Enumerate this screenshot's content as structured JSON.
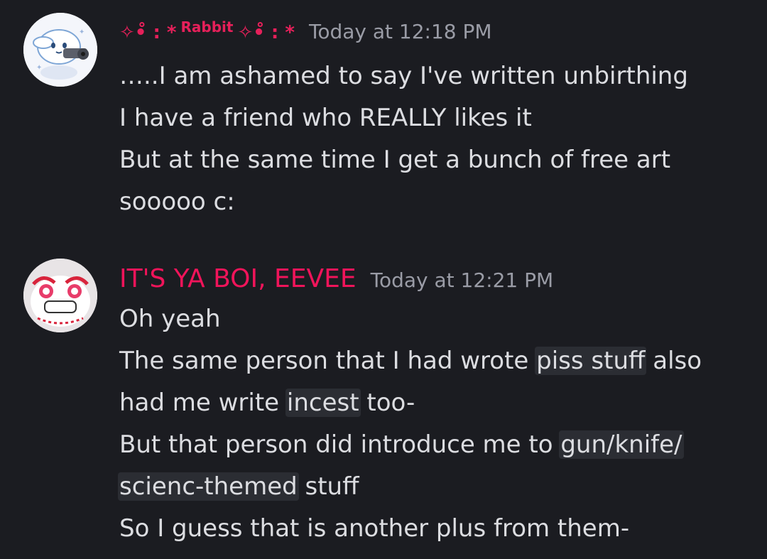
{
  "messages": [
    {
      "author": {
        "name": "Rabbit",
        "decor_left": "✧•̊ : *",
        "decor_right": "✧•̊ : *",
        "color": "#e6205a"
      },
      "timestamp": "Today at 12:18 PM",
      "avatar_icon": "cinnamoroll-with-gun-avatar",
      "lines": [
        "…..I am ashamed to say I've written unbirthing",
        "I have a friend who REALLY likes it",
        "But at the same time I get a bunch of free art",
        "sooooo c:"
      ]
    },
    {
      "author": {
        "name": "IT'S YA BOI, EEVEE",
        "color": "#f0145a"
      },
      "timestamp": "Today at 12:21 PM",
      "avatar_icon": "cartoon-face-avatar",
      "lines": [
        {
          "pre": "Oh yeah"
        },
        {
          "pre": "The same person that I had wrote ",
          "spoiler": "piss stuff",
          "post": " also"
        },
        {
          "pre": "had me write ",
          "spoiler": "incest",
          "post": " too-"
        },
        {
          "pre": "But that person did introduce me to ",
          "spoiler": "gun/knife/",
          "post": ""
        },
        {
          "pre": "",
          "spoiler": "scienc-themed",
          "post": " stuff"
        },
        {
          "pre": "So I guess that is another plus from them-"
        }
      ]
    }
  ],
  "colors": {
    "background": "#1b1c21",
    "text": "#dcdde1",
    "timestamp": "#9a9ca6",
    "spoiler_bg": "#2b2d33",
    "name_pink": "#e6205a"
  }
}
